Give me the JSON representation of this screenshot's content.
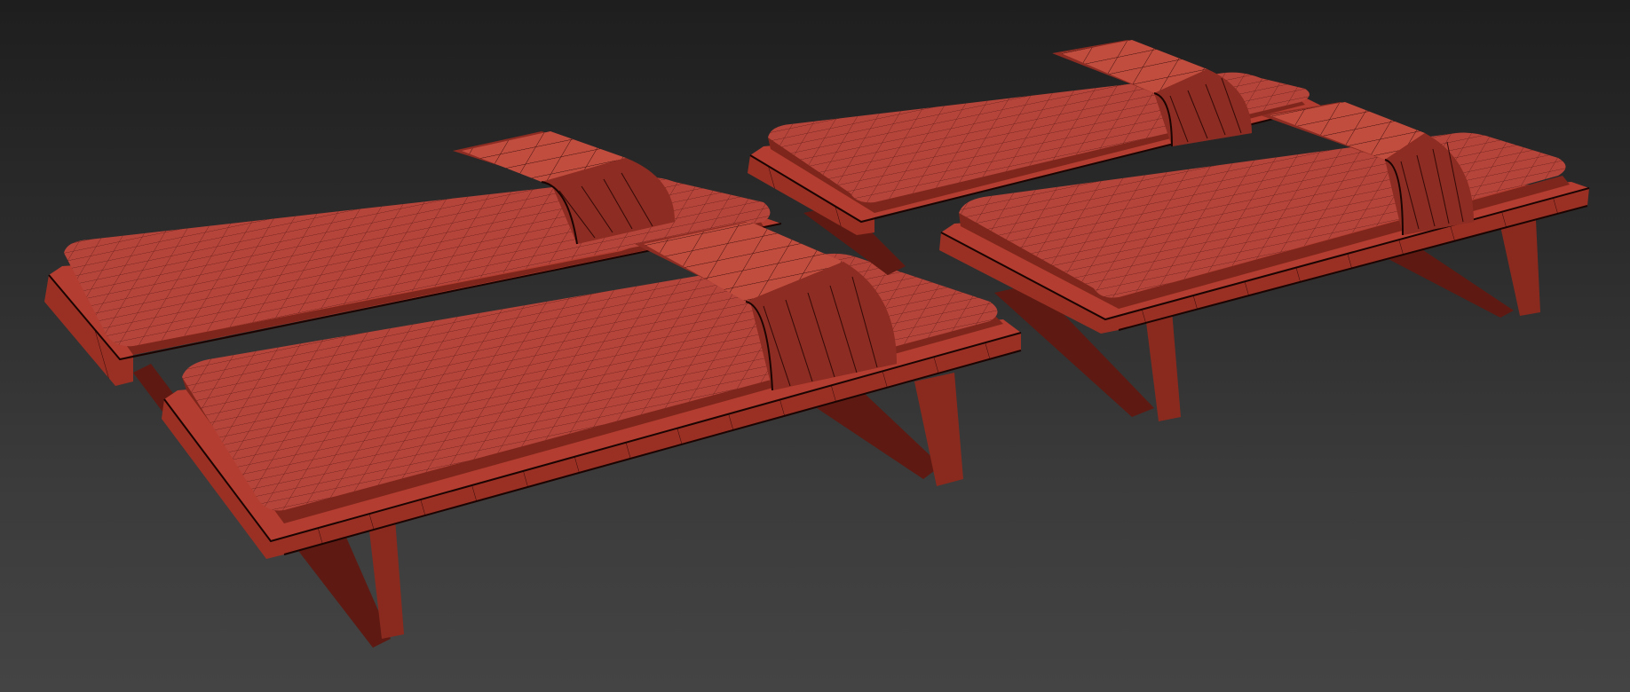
{
  "scene": {
    "background_top": "#1e1e1e",
    "background_bottom": "#444444",
    "model_color": "#a8362a",
    "wire_color": "#2a0704",
    "objects": [
      {
        "id": "daybed-back-left",
        "kind": "daybed with headrest pad"
      },
      {
        "id": "daybed-front-left",
        "kind": "daybed with headrest pad"
      },
      {
        "id": "daybed-back-right",
        "kind": "daybed with headrest pad"
      },
      {
        "id": "daybed-front-right",
        "kind": "daybed with headrest pad"
      }
    ]
  }
}
